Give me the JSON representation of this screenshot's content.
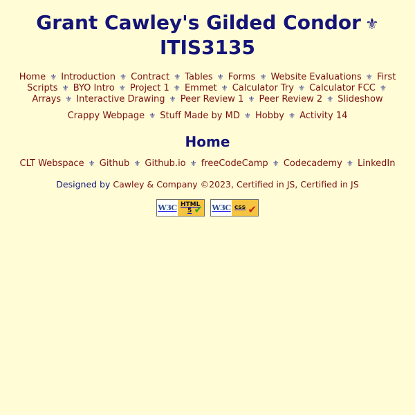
{
  "header": {
    "title_line1": "Grant Cawley's Gilded Condor",
    "fleur": "⚜",
    "title_line2": "ITIS3135"
  },
  "nav_main": [
    {
      "label": "Home"
    },
    {
      "label": "Introduction"
    },
    {
      "label": "Contract"
    },
    {
      "label": "Tables"
    },
    {
      "label": "Forms"
    },
    {
      "label": "Website Evaluations"
    },
    {
      "label": "First Scripts"
    },
    {
      "label": "BYO Intro"
    },
    {
      "label": "Project 1"
    },
    {
      "label": "Emmet"
    },
    {
      "label": "Calculator Try"
    },
    {
      "label": "Calculator FCC"
    },
    {
      "label": "Arrays"
    },
    {
      "label": "Interactive Drawing"
    },
    {
      "label": "Peer Review 1"
    },
    {
      "label": "Peer Review 2"
    },
    {
      "label": "Slideshow"
    }
  ],
  "nav_sub": [
    {
      "label": "Crappy Webpage"
    },
    {
      "label": "Stuff Made by MD"
    },
    {
      "label": "Hobby"
    },
    {
      "label": "Activity 14"
    }
  ],
  "separator": "⚜",
  "main": {
    "heading": "Home"
  },
  "external_links": [
    {
      "label": "CLT Webspace"
    },
    {
      "label": "Github"
    },
    {
      "label": "Github.io"
    },
    {
      "label": "freeCodeCamp"
    },
    {
      "label": "Codecademy"
    },
    {
      "label": "LinkedIn"
    }
  ],
  "footer": {
    "designed_by": "Designed by",
    "company": "Cawley & Company ©2023, Certified in JS, Certified in JS"
  },
  "badges": {
    "html": {
      "w3c": "W3C",
      "line1": "HTML",
      "line2": "5",
      "check": "✔"
    },
    "css": {
      "w3c": "W3C",
      "line1": "css",
      "line2": "",
      "check": "✔"
    }
  },
  "colors": {
    "background": "#fffcd6",
    "heading": "#141478",
    "link": "#7a1010",
    "separator": "#3a3a8c"
  }
}
